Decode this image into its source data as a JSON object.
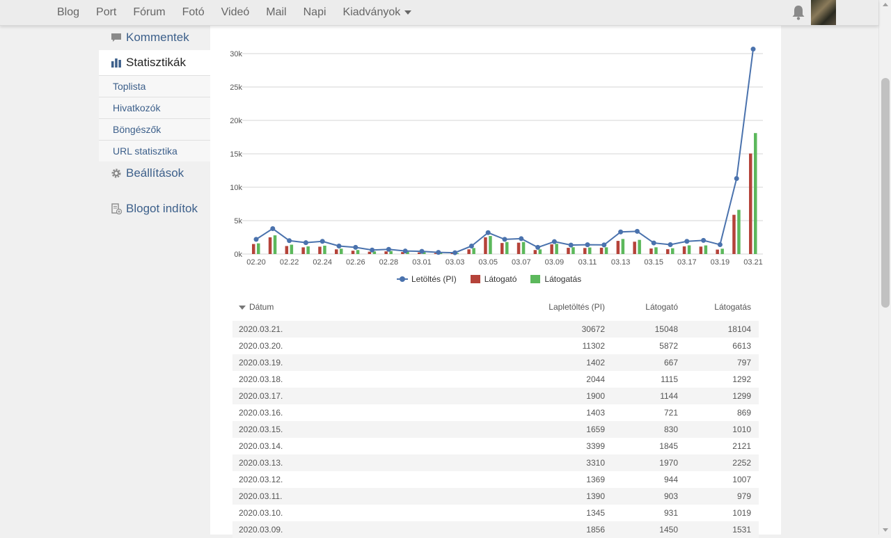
{
  "nav": {
    "items": [
      "Blog",
      "Port",
      "Fórum",
      "Fotó",
      "Videó",
      "Mail",
      "Napi"
    ],
    "dropdown_label": "Kiadványok"
  },
  "sidebar": {
    "comments": "Kommentek",
    "stats": "Statisztikák",
    "sub": [
      "Toplista",
      "Hivatkozók",
      "Böngészők",
      "URL statisztika"
    ],
    "settings": "Beállítások",
    "blog_starter": "Blogot indítok"
  },
  "colors": {
    "line": "#4a72ad",
    "visitors": "#b5433a",
    "visits": "#5cb85c",
    "link": "#3c5f8a"
  },
  "chart_data": {
    "type": "bar+line",
    "x_tick_labels": [
      "02.20",
      "02.22",
      "02.24",
      "02.26",
      "02.28",
      "03.01",
      "03.03",
      "03.05",
      "03.07",
      "03.09",
      "03.11",
      "03.13",
      "03.15",
      "03.17",
      "03.19",
      "03.21"
    ],
    "y_tick_labels": [
      "0k",
      "5k",
      "10k",
      "15k",
      "20k",
      "25k",
      "30k"
    ],
    "ylim": [
      0,
      30000
    ],
    "categories": [
      "02.20",
      "02.21",
      "02.22",
      "02.23",
      "02.24",
      "02.25",
      "02.26",
      "02.27",
      "02.28",
      "02.29",
      "03.01",
      "03.02",
      "03.03",
      "03.04",
      "03.05",
      "03.06",
      "03.07",
      "03.08",
      "03.09",
      "03.10",
      "03.11",
      "03.12",
      "03.13",
      "03.14",
      "03.15",
      "03.16",
      "03.17",
      "03.18",
      "03.19",
      "03.20",
      "03.21"
    ],
    "series": [
      {
        "name": "Letöltés (PI)",
        "kind": "line",
        "values": [
          2200,
          3800,
          2000,
          1700,
          1900,
          1200,
          1000,
          600,
          700,
          450,
          400,
          250,
          200,
          1200,
          3200,
          2200,
          2300,
          1000,
          1856,
          1345,
          1390,
          1369,
          3310,
          3399,
          1659,
          1403,
          1900,
          2044,
          1402,
          11302,
          30672
        ]
      },
      {
        "name": "Látogató",
        "kind": "bar",
        "values": [
          1500,
          2500,
          1200,
          1000,
          1100,
          700,
          500,
          350,
          400,
          300,
          250,
          150,
          120,
          700,
          2500,
          1650,
          1700,
          600,
          1450,
          931,
          903,
          944,
          1970,
          1845,
          830,
          721,
          1144,
          1115,
          667,
          5872,
          15048
        ]
      },
      {
        "name": "Látogatás",
        "kind": "bar",
        "values": [
          1600,
          2800,
          1400,
          1150,
          1250,
          800,
          600,
          400,
          450,
          350,
          280,
          170,
          140,
          900,
          2700,
          1800,
          1800,
          700,
          1531,
          1019,
          979,
          1007,
          2252,
          2121,
          1010,
          869,
          1299,
          1292,
          797,
          6613,
          18104
        ]
      }
    ]
  },
  "table": {
    "headers": [
      "Dátum",
      "Lapletöltés (PI)",
      "Látogató",
      "Látogatás"
    ],
    "rows": [
      [
        "2020.03.21.",
        "30672",
        "15048",
        "18104"
      ],
      [
        "2020.03.20.",
        "11302",
        "5872",
        "6613"
      ],
      [
        "2020.03.19.",
        "1402",
        "667",
        "797"
      ],
      [
        "2020.03.18.",
        "2044",
        "1115",
        "1292"
      ],
      [
        "2020.03.17.",
        "1900",
        "1144",
        "1299"
      ],
      [
        "2020.03.16.",
        "1403",
        "721",
        "869"
      ],
      [
        "2020.03.15.",
        "1659",
        "830",
        "1010"
      ],
      [
        "2020.03.14.",
        "3399",
        "1845",
        "2121"
      ],
      [
        "2020.03.13.",
        "3310",
        "1970",
        "2252"
      ],
      [
        "2020.03.12.",
        "1369",
        "944",
        "1007"
      ],
      [
        "2020.03.11.",
        "1390",
        "903",
        "979"
      ],
      [
        "2020.03.10.",
        "1345",
        "931",
        "1019"
      ],
      [
        "2020.03.09.",
        "1856",
        "1450",
        "1531"
      ]
    ]
  }
}
